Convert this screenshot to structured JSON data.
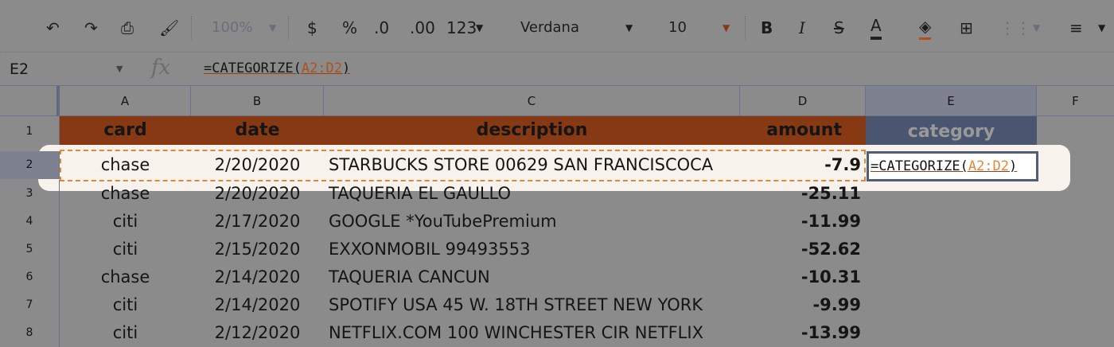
{
  "toolbar": {
    "zoom": "100%",
    "currency": "$",
    "percent": "%",
    "dec_decrease": ".0",
    "dec_increase": ".00",
    "format": "123",
    "font": "Verdana",
    "size": "10",
    "bold": "B",
    "italic": "I",
    "strike": "S",
    "text_color": "A"
  },
  "formula_bar": {
    "cell_ref": "E2",
    "fx": "fx",
    "formula_prefix": "=CATEGORIZE(",
    "formula_range": "A2:D2",
    "formula_suffix": ")"
  },
  "columns": [
    "A",
    "B",
    "C",
    "D",
    "E",
    "F"
  ],
  "header": {
    "card": "card",
    "date": "date",
    "description": "description",
    "amount": "amount",
    "category": "category"
  },
  "rows": [
    {
      "n": "2",
      "card": "chase",
      "date": "2/20/2020",
      "description": "STARBUCKS STORE 00629 SAN FRANCISCOCA",
      "amount": "-7.9"
    },
    {
      "n": "3",
      "card": "chase",
      "date": "2/20/2020",
      "description": "TAQUERIA EL GAULLO",
      "amount": "-25.11"
    },
    {
      "n": "4",
      "card": "citi",
      "date": "2/17/2020",
      "description": "GOOGLE *YouTubePremium",
      "amount": "-11.99"
    },
    {
      "n": "5",
      "card": "citi",
      "date": "2/15/2020",
      "description": "EXXONMOBIL     99493553",
      "amount": "-52.62"
    },
    {
      "n": "6",
      "card": "chase",
      "date": "2/14/2020",
      "description": "TAQUERIA CANCUN",
      "amount": "-10.31"
    },
    {
      "n": "7",
      "card": "citi",
      "date": "2/14/2020",
      "description": "SPOTIFY USA 45 W. 18TH STREET NEW YORK",
      "amount": "-9.99"
    },
    {
      "n": "8",
      "card": "citi",
      "date": "2/12/2020",
      "description": "NETFLIX.COM 100 WINCHESTER CIR NETFLIX",
      "amount": "-13.99"
    }
  ],
  "header_row_number": "1"
}
